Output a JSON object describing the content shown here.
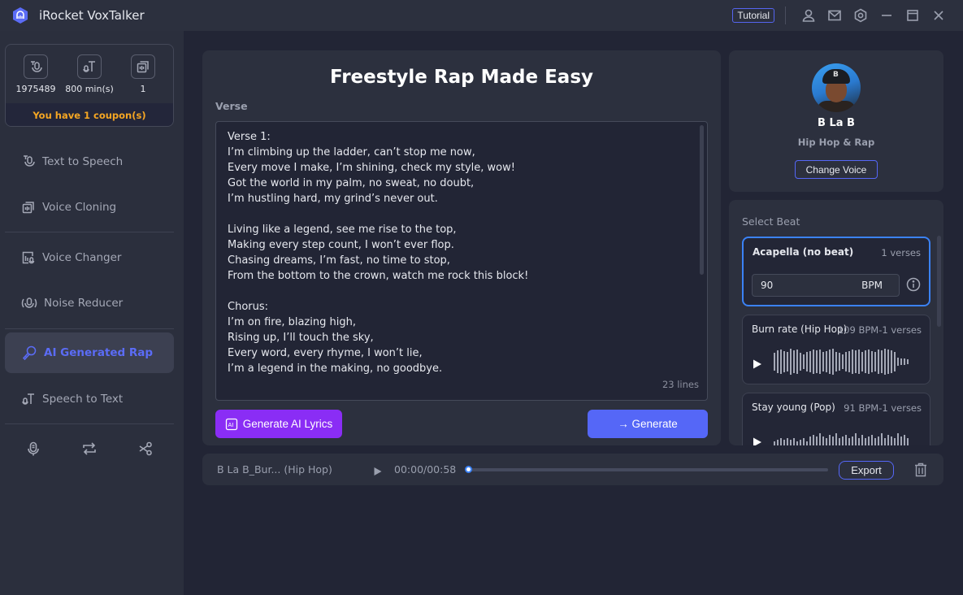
{
  "app": {
    "title": "iRocket VoxTalker",
    "tutorial_label": "Tutorial",
    "titlebar_icons": [
      "user-icon",
      "mail-icon",
      "settings-icon",
      "minimize-icon",
      "maximize-icon",
      "close-icon"
    ]
  },
  "sidebar": {
    "stats": [
      {
        "icon": "text-to-speech-icon",
        "value": "1975489"
      },
      {
        "icon": "speech-to-text-icon",
        "value": "800 min(s)"
      },
      {
        "icon": "voice-clone-icon",
        "value": "1"
      }
    ],
    "coupon": "You have 1 coupon(s)",
    "items": [
      {
        "label": "Text to Speech",
        "icon": "text-to-speech-icon"
      },
      {
        "label": "Voice Cloning",
        "icon": "voice-clone-icon"
      },
      {
        "label": "Voice Changer",
        "icon": "voice-changer-icon"
      },
      {
        "label": "Noise Reducer",
        "icon": "noise-reducer-icon"
      },
      {
        "label": "AI Generated Rap",
        "icon": "microphone-icon",
        "active": true
      },
      {
        "label": "Speech to Text",
        "icon": "speech-to-text-icon"
      }
    ],
    "tools": [
      "voice-record-icon",
      "convert-icon",
      "cut-icon"
    ]
  },
  "main": {
    "title": "Freestyle Rap Made Easy",
    "verse_label": "Verse",
    "verse_text": "Verse 1:\nI’m climbing up the ladder, can’t stop me now,\nEvery move I make, I’m shining, check my style, wow!\nGot the world in my palm, no sweat, no doubt,\nI’m hustling hard, my grind’s never out.\n\nLiving like a legend, see me rise to the top,\nMaking every step count, I won’t ever flop.\nChasing dreams, I’m fast, no time to stop,\nFrom the bottom to the crown, watch me rock this block!\n\nChorus:\nI’m on fire, blazing high,\nRising up, I’ll touch the sky,\nEvery word, every rhyme, I won’t lie,\nI’m a legend in the making, no goodbye.",
    "line_count": "23 lines",
    "generate_lyrics_label": "Generate AI Lyrics",
    "generate_label": "→ Generate"
  },
  "voice": {
    "name": "B La B",
    "genre": "Hip Hop & Rap",
    "change_label": "Change Voice"
  },
  "beats": {
    "label": "Select Beat",
    "items": [
      {
        "name": "Acapella (no beat)",
        "meta": "1 verses",
        "bpm": "90",
        "bpm_unit": "BPM",
        "selected": true
      },
      {
        "name": "Burn rate (Hip Hop)",
        "meta": "109 BPM-1 verses"
      },
      {
        "name": "Stay young (Pop)",
        "meta": "91 BPM-1 verses"
      }
    ]
  },
  "player": {
    "track": "B La B_Bur... (Hip Hop)",
    "time": "00:00/00:58",
    "progress": 0,
    "export_label": "Export"
  },
  "colors": {
    "accent": "#5567f7",
    "ai_purple": "#8a2df5",
    "coupon": "#f5a623",
    "selected_border": "#3b82f6"
  }
}
